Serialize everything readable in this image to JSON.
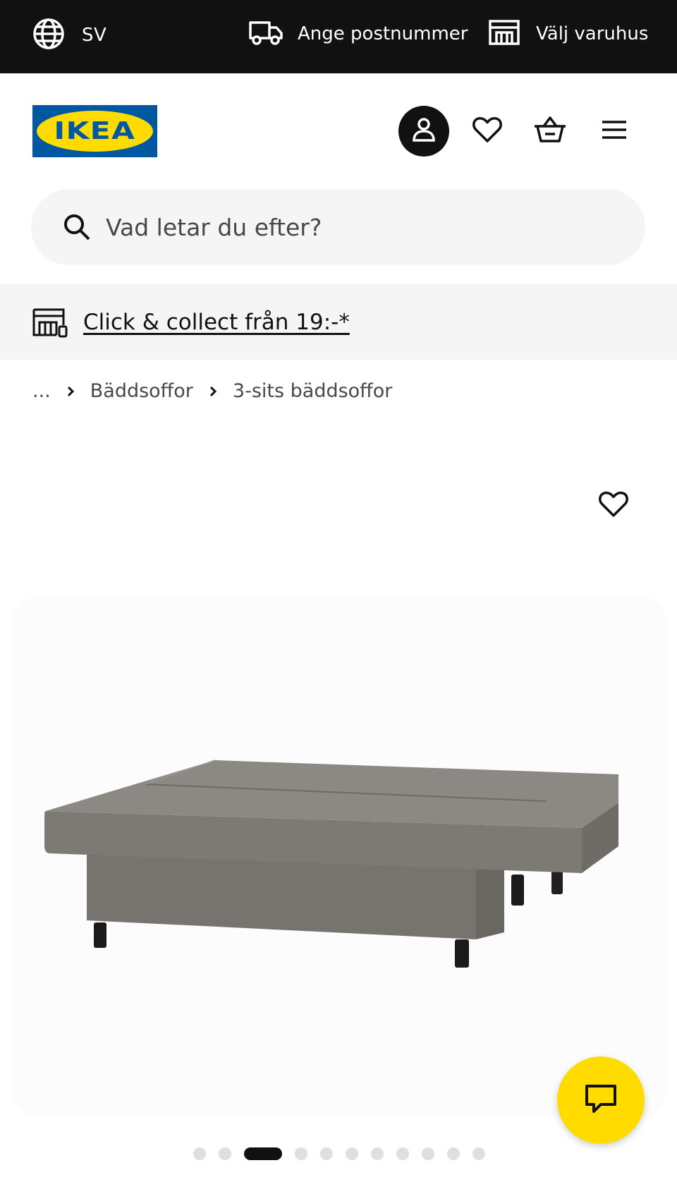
{
  "topbar": {
    "language": "SV",
    "postal_label": "Ange postnummer",
    "store_label": "Välj varuhus"
  },
  "header": {
    "logo_text": "IKEA"
  },
  "search": {
    "placeholder": "Vad letar du efter?"
  },
  "banner": {
    "click_collect": "Click & collect från 19:-*"
  },
  "breadcrumb": {
    "ellipsis": "...",
    "items": [
      "Bäddsoffor",
      "3-sits bäddsoffor"
    ]
  },
  "gallery": {
    "image_count": 11,
    "active_index": 3
  },
  "icons": {
    "language": "globe-icon",
    "postal": "truck-icon",
    "store": "store-icon",
    "account": "person-icon",
    "favorites": "heart-icon",
    "cart": "basket-icon",
    "menu": "hamburger-icon",
    "search": "search-icon",
    "click_collect": "store-locker-icon",
    "breadcrumb_separator": "chevron-right-icon",
    "chat": "chat-icon"
  },
  "colors": {
    "topbar_bg": "#111111",
    "brand_blue": "#0058a3",
    "brand_yellow": "#ffdb00",
    "banner_bg": "#f5f5f5",
    "sofa_fabric": "#7f7c77"
  }
}
